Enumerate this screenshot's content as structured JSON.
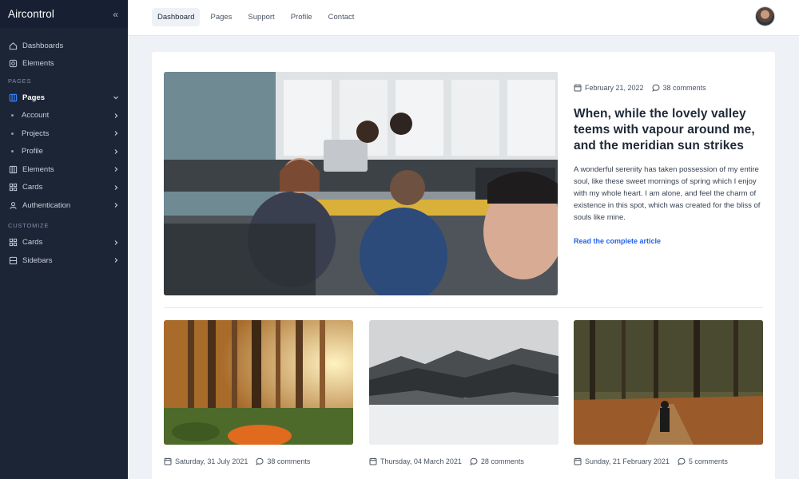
{
  "brand": {
    "name": "Aircontrol",
    "collapse_icon": "double-chevron-left-icon"
  },
  "sidebar": {
    "items_top": [
      {
        "label": "Dashboards",
        "icon": "home-icon"
      },
      {
        "label": "Elements",
        "icon": "gear-icon"
      }
    ],
    "section_pages": "PAGES",
    "pages": {
      "label": "Pages",
      "icon": "layout-icon"
    },
    "pages_sub": [
      {
        "label": "Account"
      },
      {
        "label": "Projects"
      },
      {
        "label": "Profile"
      }
    ],
    "items_mid": [
      {
        "label": "Elements",
        "icon": "columns-icon"
      },
      {
        "label": "Cards",
        "icon": "grid-icon"
      },
      {
        "label": "Authentication",
        "icon": "user-icon"
      }
    ],
    "section_customize": "CUSTOMIZE",
    "items_bottom": [
      {
        "label": "Cards",
        "icon": "grid-icon"
      },
      {
        "label": "Sidebars",
        "icon": "sidebar-icon"
      }
    ]
  },
  "topbar": {
    "nav": [
      "Dashboard",
      "Pages",
      "Support",
      "Profile",
      "Contact"
    ],
    "active": "Dashboard"
  },
  "feature": {
    "date": "February 21, 2022",
    "comments": "38 comments",
    "title": "When, while the lovely valley teems with vapour around me, and the meridian sun strikes",
    "body": "A wonderful serenity has taken possession of my entire soul, like these sweet mornings of spring which I enjoy with my whole heart. I am alone, and feel the charm of existence in this spot, which was created for the bliss of souls like mine.",
    "link": "Read the complete article"
  },
  "posts": [
    {
      "date": "Saturday, 31 July 2021",
      "comments": "38 comments"
    },
    {
      "date": "Thursday, 04 March 2021",
      "comments": "28 comments"
    },
    {
      "date": "Sunday, 21 February 2021",
      "comments": "5 comments"
    }
  ],
  "colors": {
    "sidebar_bg": "#1c2536",
    "accent": "#2563eb",
    "page_bg": "#eef1f6"
  }
}
